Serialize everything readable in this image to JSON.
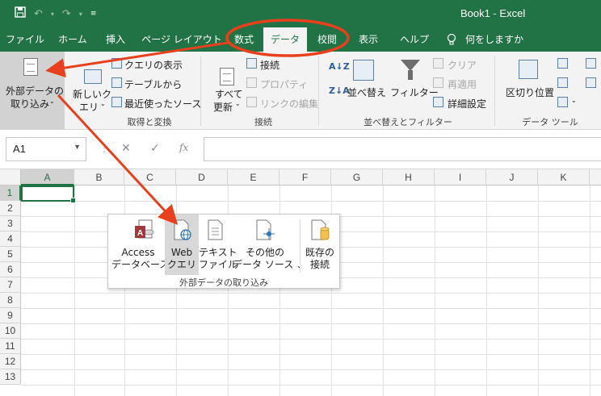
{
  "title_bar": {
    "title": "Book1  -  Excel",
    "qat": {
      "save_icon": "save-icon",
      "undo_icon": "undo-icon",
      "redo_icon": "redo-icon",
      "customize_icon": "customize-qat-icon"
    }
  },
  "tabs": [
    {
      "label": "ファイル"
    },
    {
      "label": "ホーム"
    },
    {
      "label": "挿入"
    },
    {
      "label": "ページ レイアウト"
    },
    {
      "label": "数式"
    },
    {
      "label": "データ"
    },
    {
      "label": "校閲"
    },
    {
      "label": "表示"
    },
    {
      "label": "ヘルプ"
    },
    {
      "label": "何をしますか"
    }
  ],
  "ribbon": {
    "get_transform": {
      "external_data_line1": "外部データの",
      "external_data_line2": "取り込み",
      "new_query_line1": "新しいク",
      "new_query_line2": "エリ",
      "show_queries": "クエリの表示",
      "from_table": "テーブルから",
      "recent_sources": "最近使ったソース",
      "group_label": "取得と変換"
    },
    "connections": {
      "refresh_all_line1": "すべて",
      "refresh_all_line2": "更新",
      "connections": "接続",
      "properties": "プロパティ",
      "edit_links": "リンクの編集",
      "group_label": "接続"
    },
    "sort_filter": {
      "sort": "並べ替え",
      "filter": "フィルター",
      "clear": "クリア",
      "reapply": "再適用",
      "advanced": "詳細設定",
      "group_label": "並べ替えとフィルター"
    },
    "data_tools": {
      "text_to_columns": "区切り位置",
      "group_label": "データ ツール"
    }
  },
  "formula_bar": {
    "name_box": "A1",
    "cancel_symbol": "✕",
    "enter_symbol": "✓",
    "fx_symbol": "fx",
    "formula": ""
  },
  "sheet": {
    "columns": [
      "A",
      "B",
      "C",
      "D",
      "E",
      "F",
      "G",
      "H",
      "I",
      "J",
      "K"
    ],
    "rows": [
      "1",
      "2",
      "3",
      "4",
      "5",
      "6",
      "7",
      "8",
      "9",
      "10",
      "11",
      "12",
      "13"
    ],
    "active_cell": "A1"
  },
  "popup": {
    "access_line1": "Access",
    "access_line2": "データベース",
    "web_line1": "Web",
    "web_line2": "クエリ",
    "text_line1": "テキスト",
    "text_line2": "ファイル",
    "other_line1": "その他の",
    "other_line2": "データ ソース",
    "existing_line1": "既存の",
    "existing_line2": "接続",
    "group_label": "外部データの取り込み"
  },
  "colors": {
    "excel_green": "#217346",
    "annotation_red": "#e8401c"
  }
}
